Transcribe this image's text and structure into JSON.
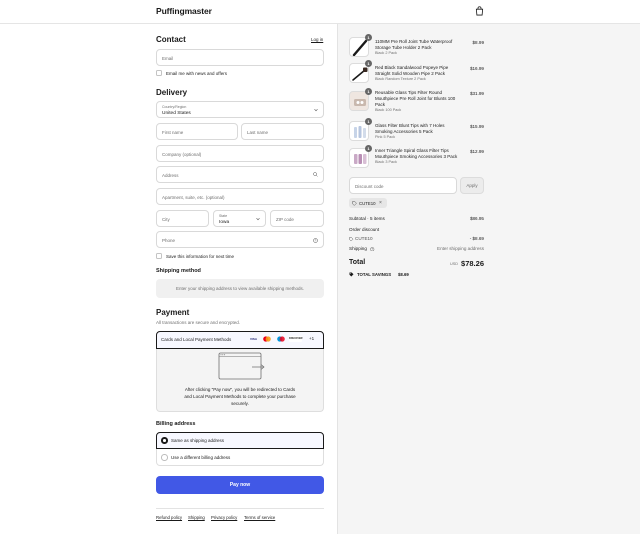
{
  "header": {
    "brand": "Puffingmaster",
    "cart_icon": "shopping-bag-icon"
  },
  "contact": {
    "heading": "Contact",
    "login_link": "Log in",
    "email_placeholder": "Email",
    "newsletter_label": "Email me with news and offers"
  },
  "delivery": {
    "heading": "Delivery",
    "country_label": "Country/Region",
    "country_value": "United States",
    "first_name_placeholder": "First name",
    "last_name_placeholder": "Last name",
    "company_placeholder": "Company (optional)",
    "address_placeholder": "Address",
    "apartment_placeholder": "Apartment, suite, etc. (optional)",
    "city_placeholder": "City",
    "state_label": "State",
    "state_value": "Iowa",
    "zip_placeholder": "ZIP code",
    "phone_placeholder": "Phone",
    "save_info_label": "Save this information for next time"
  },
  "shipping_method": {
    "heading": "Shipping method",
    "notice": "Enter your shipping address to view available shipping methods."
  },
  "payment": {
    "heading": "Payment",
    "subtext": "All transactions are secure and encrypted.",
    "method_label": "Cards and Local Payment Methods",
    "card_logos": [
      "VISA",
      "MC",
      "MAESTRO",
      "DISCOVER"
    ],
    "more_count": "+1",
    "redirect_text_1": "After clicking \"Pay now\", you will be redirected to Cards",
    "redirect_text_2": "and Local Payment Methods to complete your purchase",
    "redirect_text_3": "securely."
  },
  "billing": {
    "heading": "Billing address",
    "option_same": "Same as shipping address",
    "option_different": "Use a different billing address"
  },
  "pay_button": "Pay now",
  "footer": {
    "refund": "Refund policy",
    "shipping": "Shipping",
    "privacy": "Privacy policy",
    "terms": "Terms of service"
  },
  "order": {
    "items": [
      {
        "qty": "1",
        "title": "110MM Pre Roll Joint Tube Waterproof Storage Tube Holder 2 Pack",
        "variant": "Black 2 Pack",
        "price": "$8.99"
      },
      {
        "qty": "1",
        "title": "Red Black Sandalwood Popeye Pipe Straight Solid Wooden Pipe 2 Pack",
        "variant": "Black Random Texture 2 Pack",
        "price": "$16.99"
      },
      {
        "qty": "1",
        "title": "Reusable Glass Tips Filter Round Mouthpiece Pre Roll Joint for Blunts 100 Pack",
        "variant": "Black 100 Pack",
        "price": "$31.99"
      },
      {
        "qty": "1",
        "title": "Glass Filter Blunt Tips with 7 Holes Smoking Accessories 5 Pack",
        "variant": "Pink 5 Pack",
        "price": "$15.99"
      },
      {
        "qty": "1",
        "title": "Inner Triangle Spiral Glass Filter Tips Mouthpiece Smoking Accessories 3 Pack",
        "variant": "Black 3 Pack",
        "price": "$12.99"
      }
    ],
    "discount_placeholder": "Discount code",
    "apply_label": "Apply",
    "applied_code": "CUTE10",
    "subtotal_label": "Subtotal · 5 items",
    "subtotal_value": "$86.95",
    "order_discount_label": "Order discount",
    "discount_code_line": "CUTE10",
    "discount_value": "- $8.69",
    "shipping_label": "Shipping",
    "shipping_value": "Enter shipping address",
    "total_label": "Total",
    "currency": "USD",
    "total_value": "$78.26",
    "savings_label": "TOTAL SAVINGS",
    "savings_value": "$8.69"
  },
  "colors": {
    "accent": "#4158e6",
    "panel_bg": "#f5f5f5"
  }
}
